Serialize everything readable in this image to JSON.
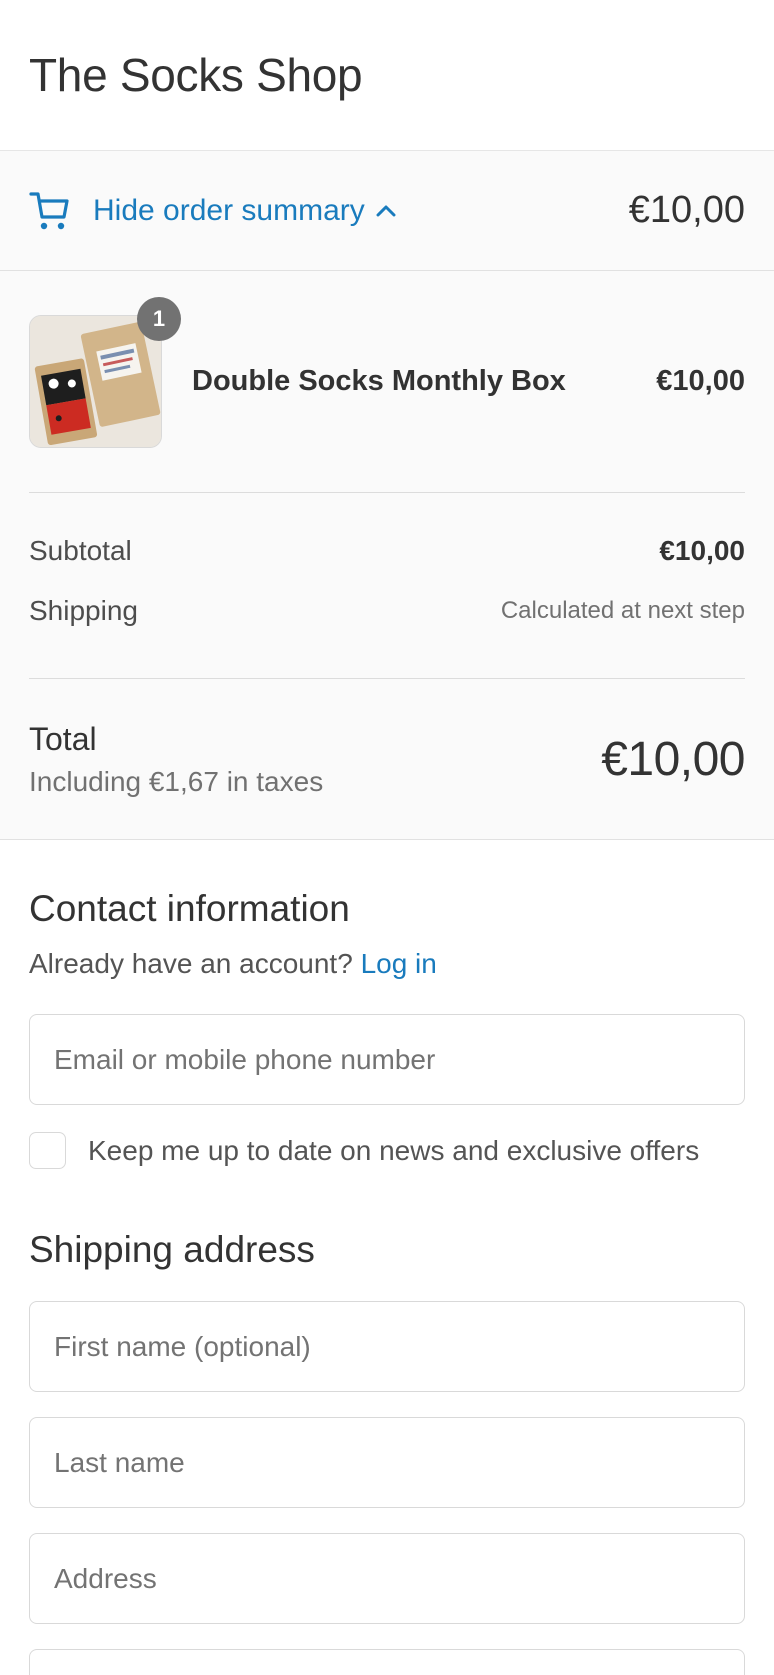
{
  "header": {
    "shop_title": "The Socks Shop"
  },
  "summary_toggle": {
    "label": "Hide order summary",
    "total": "€10,00",
    "icon": "cart-icon",
    "chevron": "chevron-up-icon",
    "accent_color": "#197bbd"
  },
  "order": {
    "items": [
      {
        "quantity": "1",
        "name": "Double Socks Monthly Box",
        "price": "€10,00"
      }
    ],
    "subtotal_label": "Subtotal",
    "subtotal_value": "€10,00",
    "shipping_label": "Shipping",
    "shipping_value": "Calculated at next step",
    "total_label": "Total",
    "taxes_note": "Including €1,67 in taxes",
    "total_value": "€10,00"
  },
  "contact": {
    "title": "Contact information",
    "account_prompt": "Already have an account?",
    "login_link": "Log in",
    "email_placeholder": "Email or mobile phone number",
    "newsletter_label": "Keep me up to date on news and exclusive offers"
  },
  "shipping": {
    "title": "Shipping address",
    "first_name_placeholder": "First name (optional)",
    "last_name_placeholder": "Last name",
    "address_placeholder": "Address"
  }
}
